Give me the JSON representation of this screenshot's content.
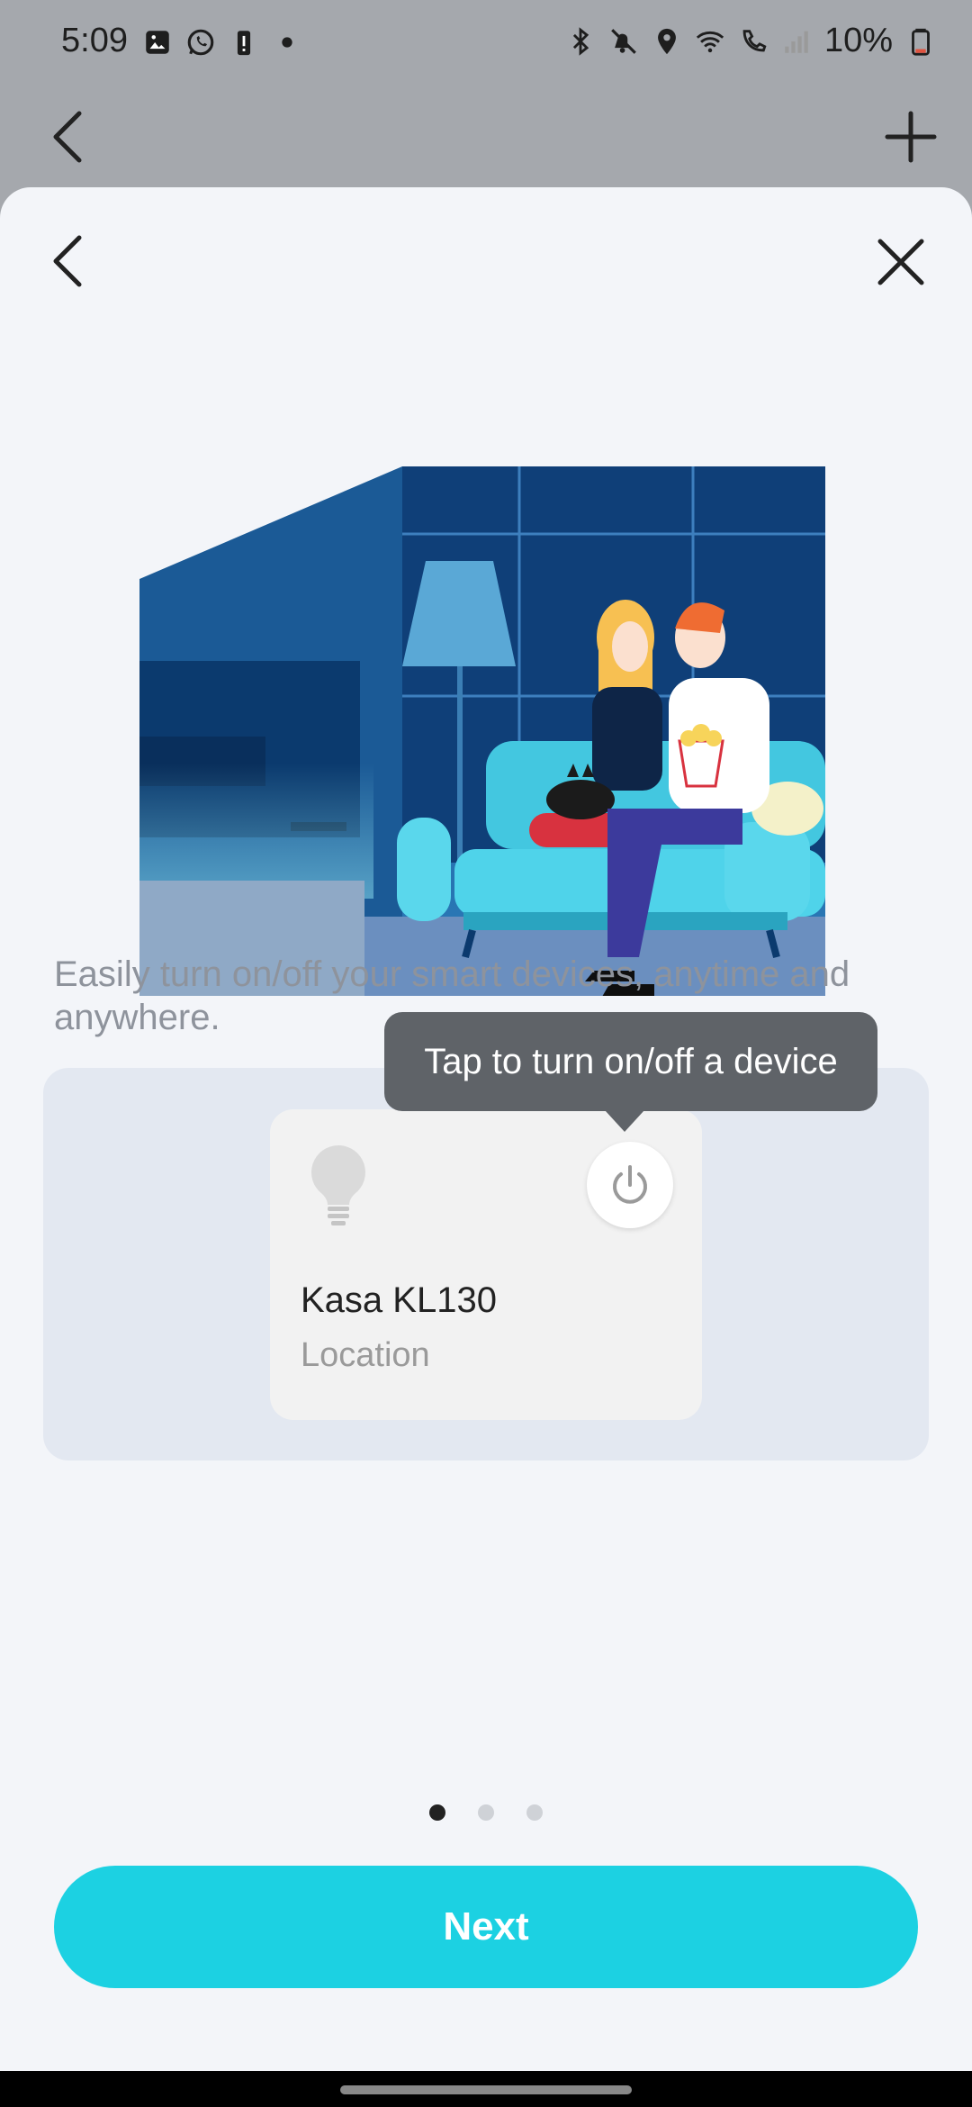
{
  "status_bar": {
    "time": "5:09",
    "battery_percent": "10%",
    "left_icons": [
      "gallery-icon",
      "whatsapp-icon",
      "battery-alert-icon",
      "dot-icon"
    ],
    "right_icons": [
      "bluetooth-icon",
      "mute-icon",
      "location-icon",
      "wifi-icon",
      "wifi-calling-icon",
      "signal-icon",
      "battery-icon"
    ]
  },
  "colors": {
    "accent": "#1cd1e2",
    "tooltip_bg": "#5f6368",
    "sheet_bg": "#f3f5f9",
    "demo_bg": "#e3e8f1"
  },
  "onboarding": {
    "description": "Easily turn on/off your smart devices, anytime and anywhere.",
    "tooltip": "Tap to turn on/off a device",
    "device": {
      "name": "Kasa KL130",
      "location": "Location",
      "icon": "lightbulb-icon",
      "power_icon": "power-icon"
    },
    "pagination": {
      "current": 1,
      "total": 3
    },
    "next_label": "Next"
  }
}
